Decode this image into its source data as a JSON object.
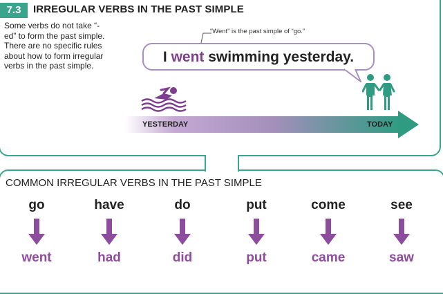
{
  "header": {
    "section_number": "7.3",
    "title": "IRREGULAR VERBS IN THE PAST SIMPLE"
  },
  "intro_text": "Some verbs do not take “-ed” to form the past simple. There are no specific rules about how to form irregular verbs in the past simple.",
  "callout_note": "“Went” is the past simple of “go.”",
  "example": {
    "before": "I ",
    "highlight": "went",
    "after": " swimming yesterday."
  },
  "timeline": {
    "start_label": "YESTERDAY",
    "end_label": "TODAY",
    "icons": [
      "swimmer-icon",
      "people-icon"
    ]
  },
  "common": {
    "title": "COMMON IRREGULAR VERBS IN THE PAST SIMPLE",
    "verbs": [
      {
        "base": "go",
        "past": "went"
      },
      {
        "base": "have",
        "past": "had"
      },
      {
        "base": "do",
        "past": "did"
      },
      {
        "base": "put",
        "past": "put"
      },
      {
        "base": "come",
        "past": "came"
      },
      {
        "base": "see",
        "past": "saw"
      }
    ]
  },
  "colors": {
    "teal": "#3aa48c",
    "purple": "#7f3d90",
    "purple_light": "#a88fbf"
  }
}
